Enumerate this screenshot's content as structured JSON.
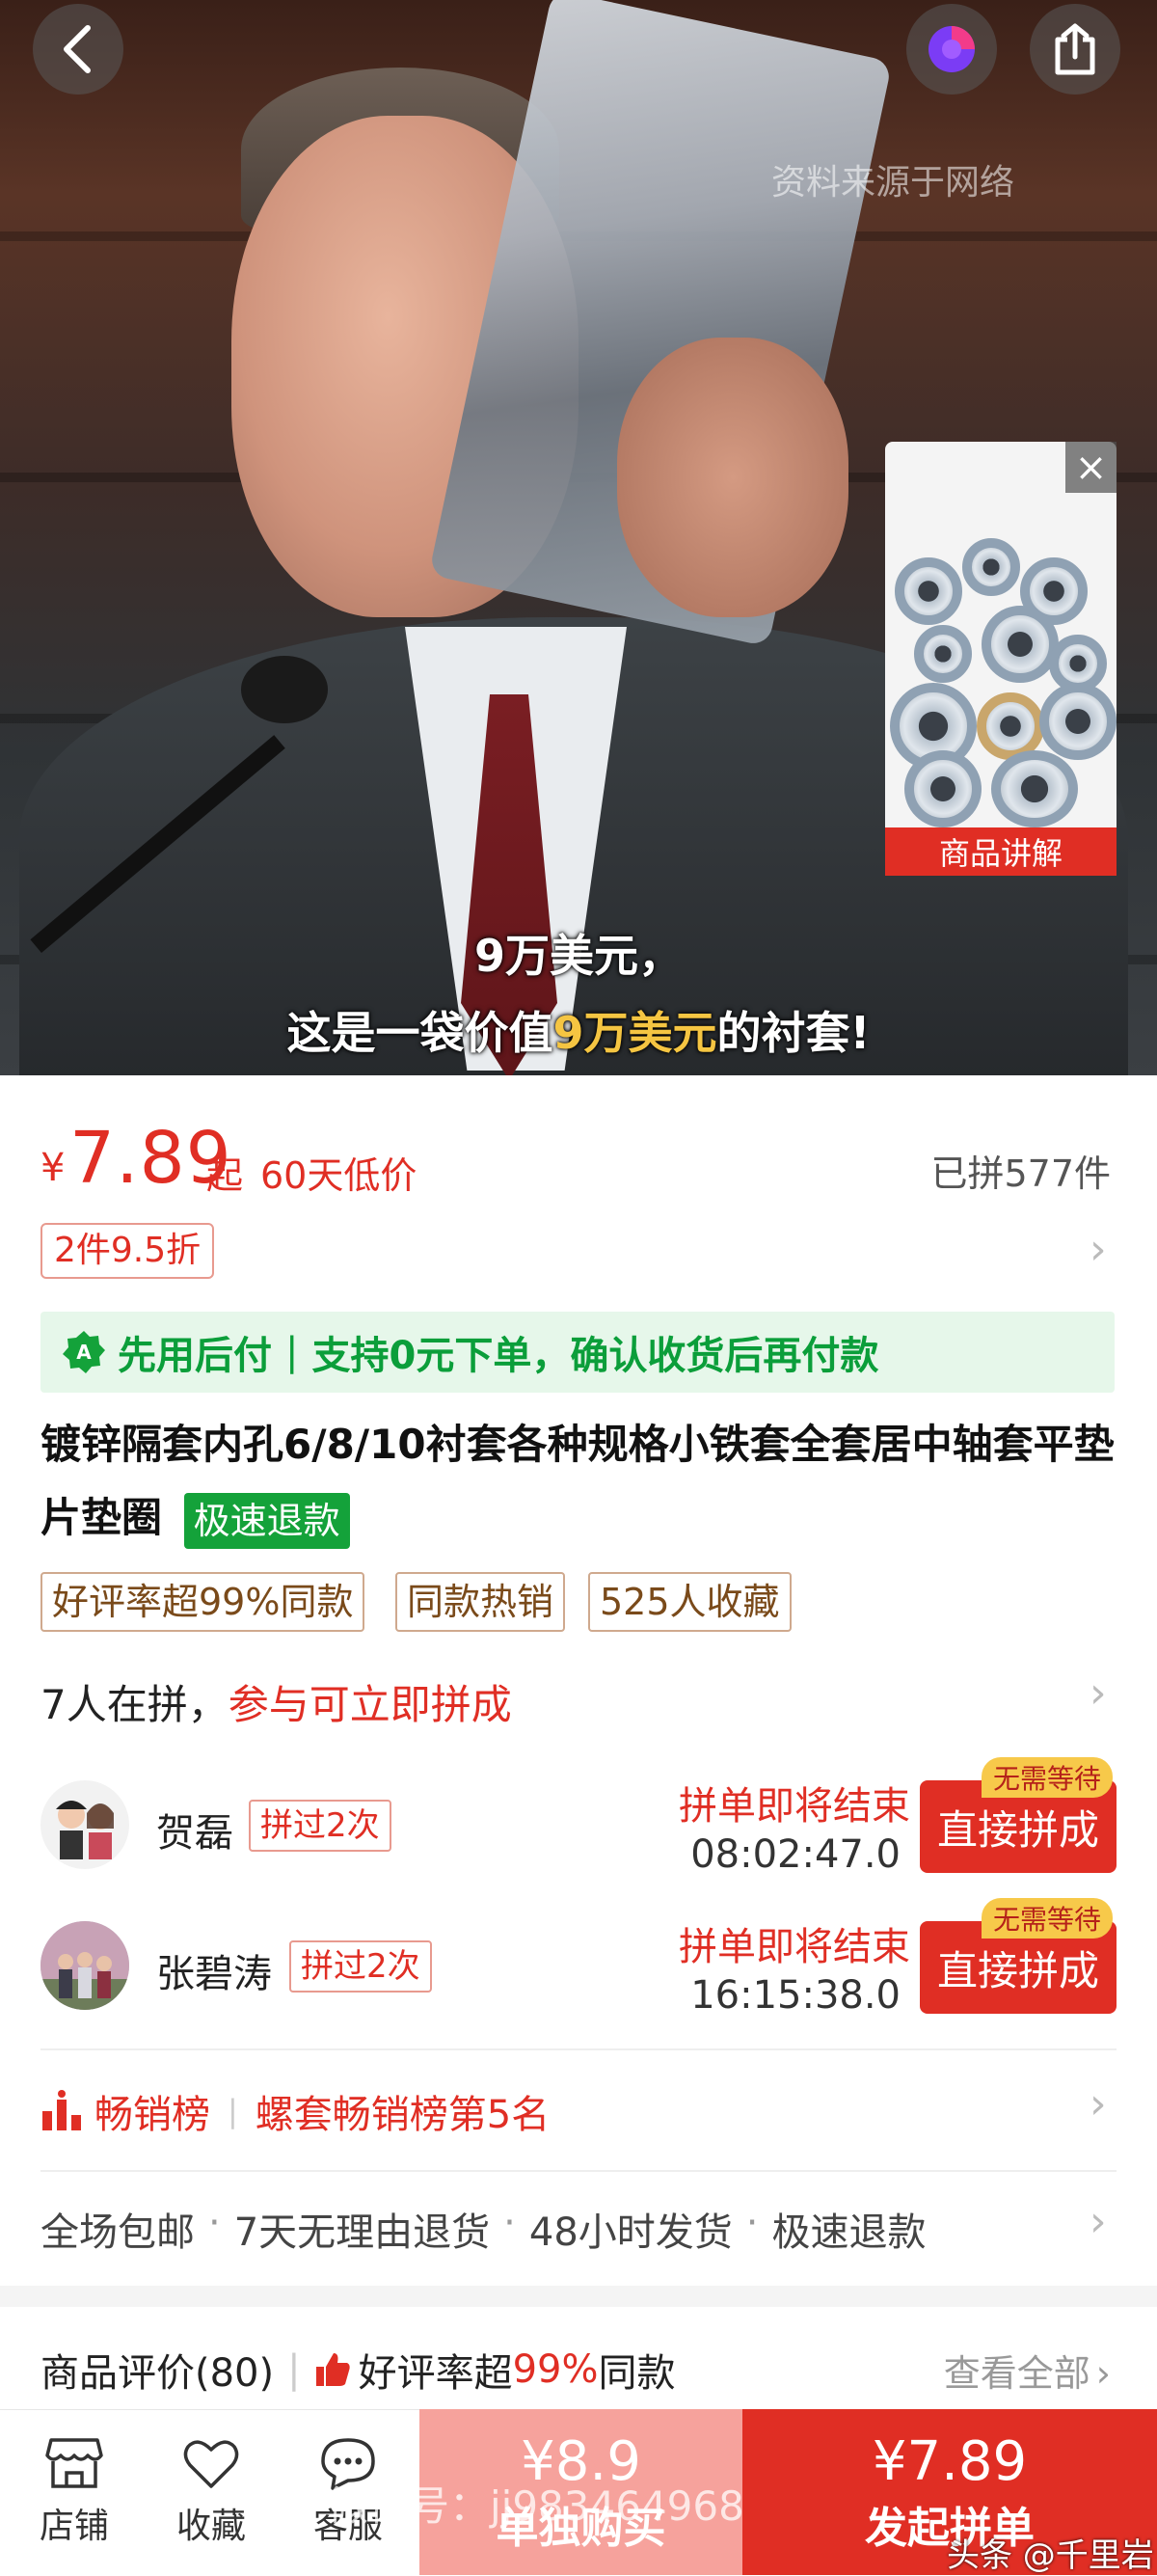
{
  "video": {
    "source_note": "资料来源于网络",
    "subtitle_line1": "9万美元，",
    "subtitle_line2_pre": "这是一袋价值",
    "subtitle_line2_highlight": "9万美元",
    "subtitle_line2_post": "的衬套!"
  },
  "product_thumb": {
    "close_symbol": "×",
    "label": "商品讲解"
  },
  "price": {
    "currency": "¥",
    "value": "7.89",
    "suffix": "起",
    "low_price_tag": "60天低价",
    "sold": "已拼577件",
    "discount_tag": "2件9.5折"
  },
  "pay_later": {
    "title": "先用后付",
    "text": "支持0元下单，确认收货后再付款"
  },
  "title": {
    "text": "镀锌隔套内孔6/8/10衬套各种规格小铁套全套居中轴套平垫片垫圈",
    "badge": "极速退款"
  },
  "chips": [
    "好评率超99%同款",
    "同款热销",
    "525人收藏"
  ],
  "group": {
    "count_text": "7人在拼，",
    "join_text": "参与可立即拼成",
    "users": [
      {
        "name": "贺磊",
        "badge": "拼过2次",
        "ending": "拼单即将结束",
        "timer": "08:02:47.0",
        "button": "直接拼成",
        "no_wait": "无需等待"
      },
      {
        "name": "张碧涛",
        "badge": "拼过2次",
        "ending": "拼单即将结束",
        "timer": "16:15:38.0",
        "button": "直接拼成",
        "no_wait": "无需等待"
      }
    ]
  },
  "ranking": {
    "label": "畅销榜",
    "text": "螺套畅销榜第5名"
  },
  "services": [
    "全场包邮",
    "7天无理由退货",
    "48小时发货",
    "极速退款"
  ],
  "reviews": {
    "title": "商品评价(80)",
    "rate_pre": "好评率超",
    "rate_value": "99%",
    "rate_post": "同款",
    "view_all": "查看全部"
  },
  "bottom_bar": {
    "store": "店铺",
    "favorite": "收藏",
    "service": "客服",
    "solo_price": "¥8.9",
    "solo_label": "单独购买",
    "group_price": "¥7.89",
    "group_label": "发起拼单"
  },
  "overlay_watermark": "微信号：jj983464968",
  "platform_watermark": "头条 @千里岩",
  "colors": {
    "accent": "#e02e24",
    "green": "#14a23a"
  }
}
